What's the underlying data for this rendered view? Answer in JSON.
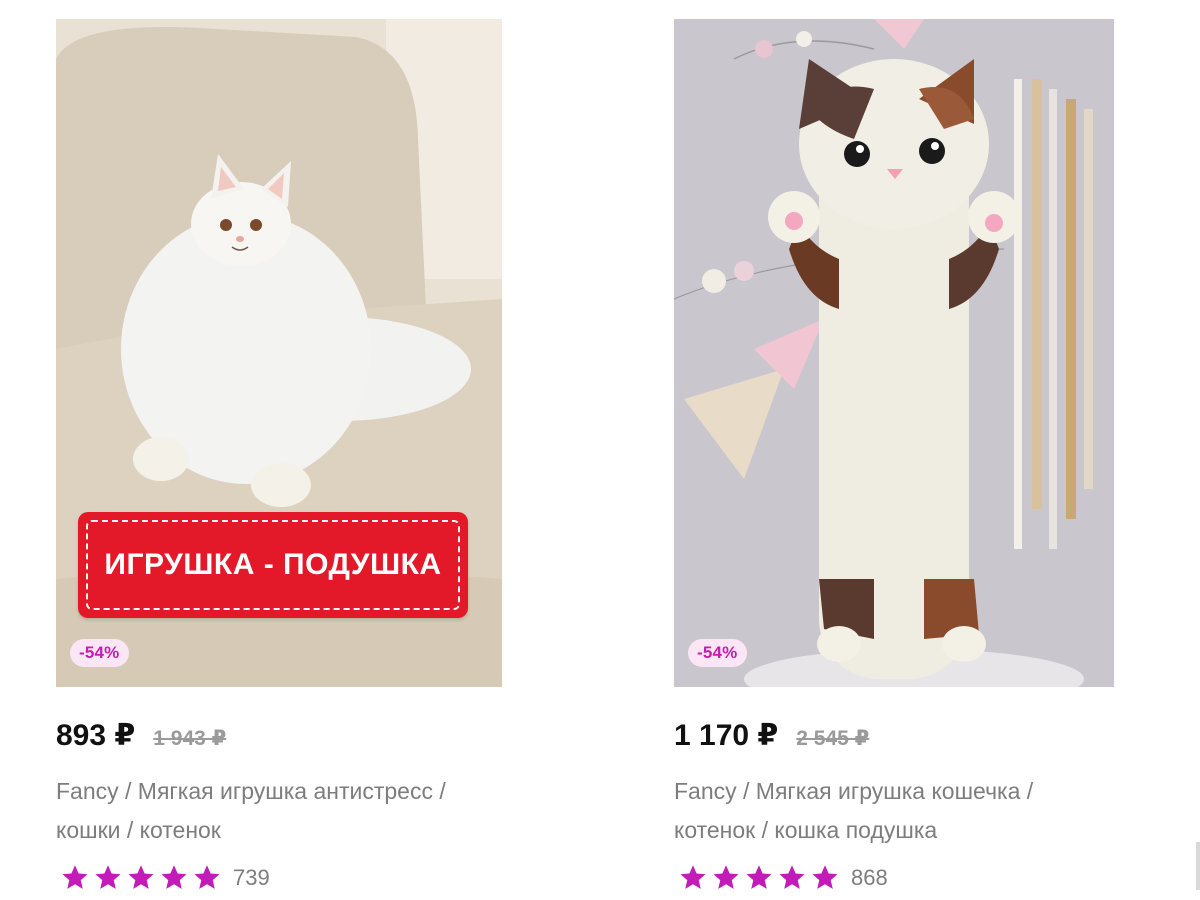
{
  "products": [
    {
      "promo_banner": "ИГРУШКА - ПОДУШКА",
      "discount": "-54%",
      "price": "893 ₽",
      "old_price": "1 943 ₽",
      "title": "Fancy / Мягкая игрушка антистресс / кошки / котенок",
      "rating": 5,
      "reviews": "739"
    },
    {
      "discount": "-54%",
      "price": "1 170 ₽",
      "old_price": "2 545 ₽",
      "title": "Fancy / Мягкая игрушка кошечка / котенок / кошка подушка",
      "rating": 5,
      "reviews": "868"
    }
  ],
  "colors": {
    "star": "#c21bb8",
    "badge_bg": "#fbe6f6",
    "badge_text": "#c41db0",
    "promo_red": "#e3192a"
  }
}
